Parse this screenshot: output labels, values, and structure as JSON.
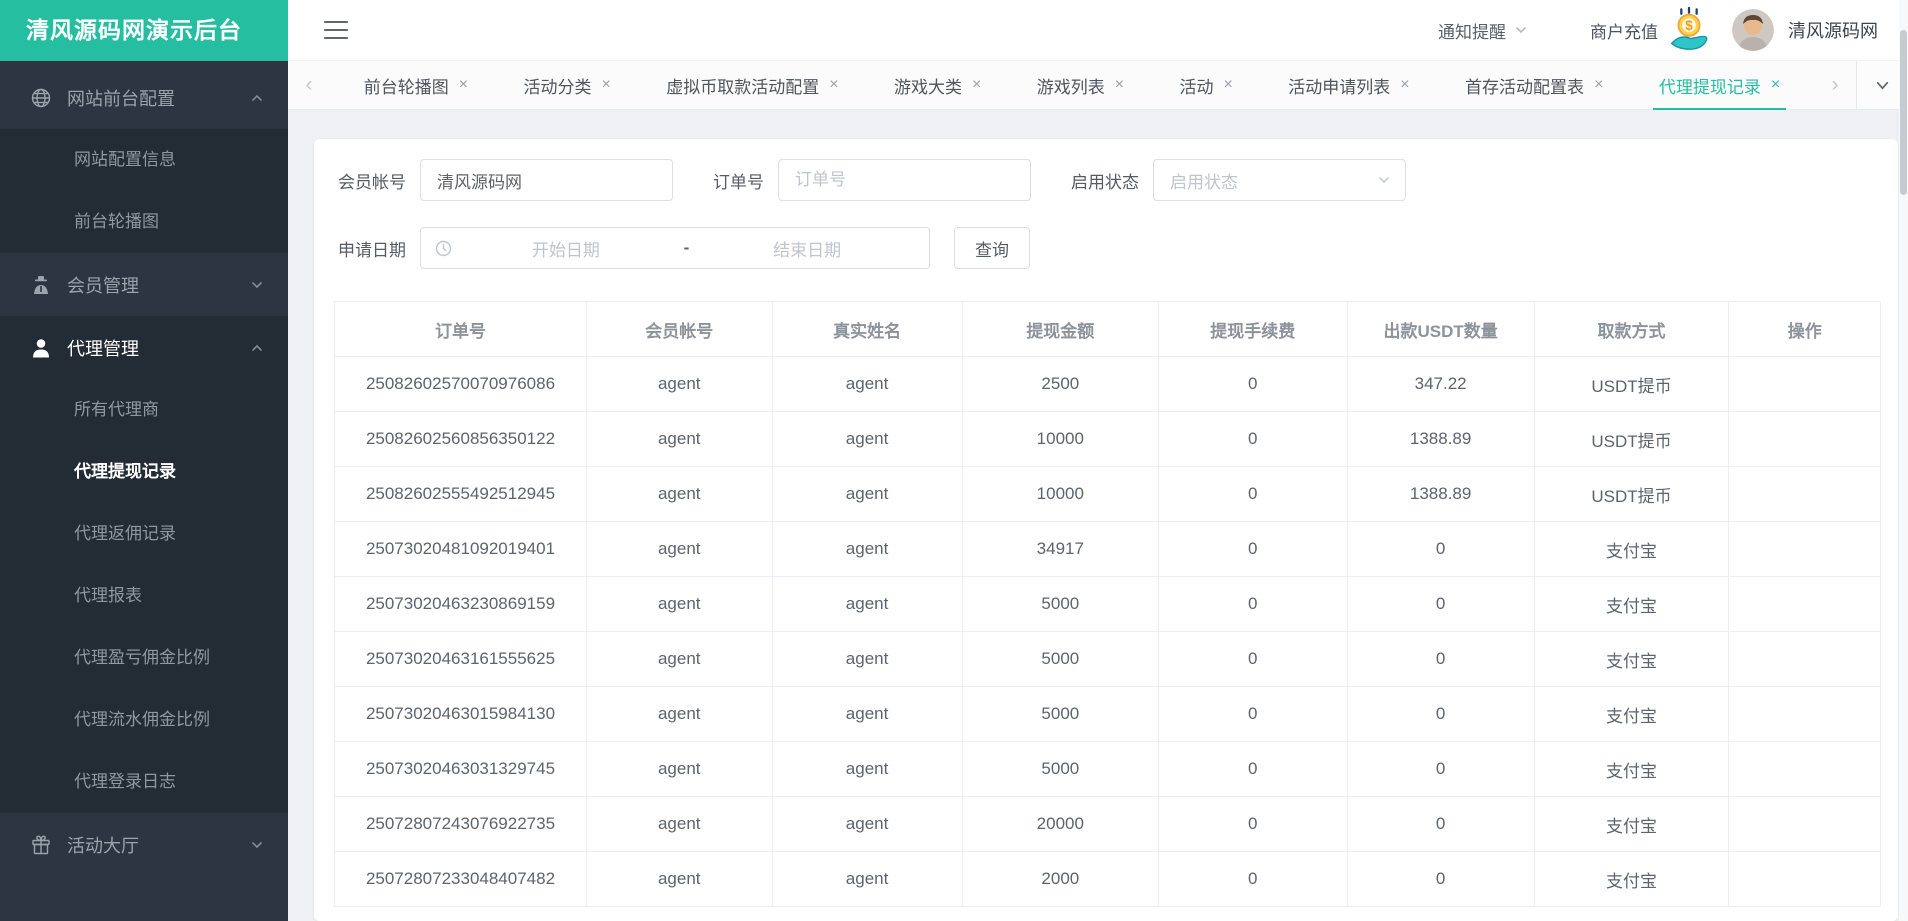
{
  "app": {
    "logo_text": "清风源码网演示后台"
  },
  "header": {
    "notice_label": "通知提醒",
    "recharge_label": "商户充值",
    "username": "清风源码网"
  },
  "sidebar": {
    "sections": [
      {
        "label": "网站前台配置",
        "icon": "globe-icon",
        "state": "expanded",
        "active": false,
        "children": [
          {
            "label": "网站配置信息",
            "active": false
          },
          {
            "label": "前台轮播图",
            "active": false
          }
        ]
      },
      {
        "label": "会员管理",
        "icon": "member-icon",
        "state": "collapsed",
        "active": false,
        "children": []
      },
      {
        "label": "代理管理",
        "icon": "agent-icon",
        "state": "expanded",
        "active": true,
        "children": [
          {
            "label": "所有代理商",
            "active": false
          },
          {
            "label": "代理提现记录",
            "active": true
          },
          {
            "label": "代理返佣记录",
            "active": false
          },
          {
            "label": "代理报表",
            "active": false
          },
          {
            "label": "代理盈亏佣金比例",
            "active": false
          },
          {
            "label": "代理流水佣金比例",
            "active": false
          },
          {
            "label": "代理登录日志",
            "active": false
          }
        ]
      },
      {
        "label": "活动大厅",
        "icon": "gift-icon",
        "state": "collapsed",
        "active": false,
        "children": []
      }
    ]
  },
  "tabbar": {
    "close_glyph": "×",
    "left_arrow": "‹",
    "right_arrow": "›",
    "tabs": [
      {
        "label": "前台轮播图",
        "active": false
      },
      {
        "label": "活动分类",
        "active": false
      },
      {
        "label": "虚拟币取款活动配置",
        "active": false
      },
      {
        "label": "游戏大类",
        "active": false
      },
      {
        "label": "游戏列表",
        "active": false
      },
      {
        "label": "活动",
        "active": false
      },
      {
        "label": "活动申请列表",
        "active": false
      },
      {
        "label": "首存活动配置表",
        "active": false
      },
      {
        "label": "代理提现记录",
        "active": true
      }
    ]
  },
  "filters": {
    "member_account": {
      "label": "会员帐号",
      "value": "清风源码网"
    },
    "order_no": {
      "label": "订单号",
      "placeholder": "订单号"
    },
    "enable_status": {
      "label": "启用状态",
      "placeholder": "启用状态"
    },
    "apply_date": {
      "label": "申请日期",
      "start_placeholder": "开始日期",
      "separator": "-",
      "end_placeholder": "结束日期"
    },
    "search_button": "查询"
  },
  "table": {
    "columns": [
      "订单号",
      "会员帐号",
      "真实姓名",
      "提现金额",
      "提现手续费",
      "出款USDT数量",
      "取款方式",
      "操作"
    ],
    "rows": [
      {
        "order_no": "25082602570070976086",
        "account": "agent",
        "real_name": "agent",
        "amount": "2500",
        "fee": "0",
        "usdt_amount": "347.22",
        "method": "USDT提币",
        "action": ""
      },
      {
        "order_no": "25082602560856350122",
        "account": "agent",
        "real_name": "agent",
        "amount": "10000",
        "fee": "0",
        "usdt_amount": "1388.89",
        "method": "USDT提币",
        "action": ""
      },
      {
        "order_no": "25082602555492512945",
        "account": "agent",
        "real_name": "agent",
        "amount": "10000",
        "fee": "0",
        "usdt_amount": "1388.89",
        "method": "USDT提币",
        "action": ""
      },
      {
        "order_no": "25073020481092019401",
        "account": "agent",
        "real_name": "agent",
        "amount": "34917",
        "fee": "0",
        "usdt_amount": "0",
        "method": "支付宝",
        "action": ""
      },
      {
        "order_no": "25073020463230869159",
        "account": "agent",
        "real_name": "agent",
        "amount": "5000",
        "fee": "0",
        "usdt_amount": "0",
        "method": "支付宝",
        "action": ""
      },
      {
        "order_no": "25073020463161555625",
        "account": "agent",
        "real_name": "agent",
        "amount": "5000",
        "fee": "0",
        "usdt_amount": "0",
        "method": "支付宝",
        "action": ""
      },
      {
        "order_no": "25073020463015984130",
        "account": "agent",
        "real_name": "agent",
        "amount": "5000",
        "fee": "0",
        "usdt_amount": "0",
        "method": "支付宝",
        "action": ""
      },
      {
        "order_no": "25073020463031329745",
        "account": "agent",
        "real_name": "agent",
        "amount": "5000",
        "fee": "0",
        "usdt_amount": "0",
        "method": "支付宝",
        "action": ""
      },
      {
        "order_no": "25072807243076922735",
        "account": "agent",
        "real_name": "agent",
        "amount": "20000",
        "fee": "0",
        "usdt_amount": "0",
        "method": "支付宝",
        "action": ""
      },
      {
        "order_no": "25072807233048407482",
        "account": "agent",
        "real_name": "agent",
        "amount": "2000",
        "fee": "0",
        "usdt_amount": "0",
        "method": "支付宝",
        "action": ""
      }
    ]
  },
  "colors": {
    "accent": "#26bea0",
    "sidebar_bg": "#2c3540",
    "sidebar_submenu_bg": "#232c35",
    "table_border": "#ebeef5"
  }
}
